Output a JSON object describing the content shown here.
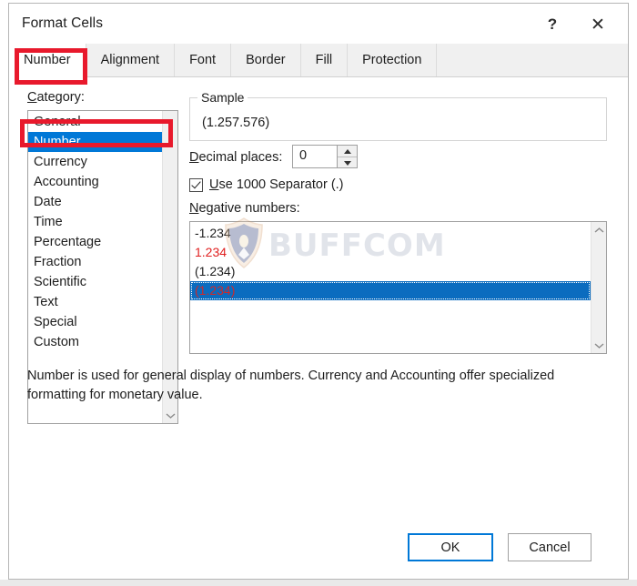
{
  "window": {
    "title": "Format Cells",
    "help_icon": "question-mark-icon",
    "close_icon": "close-icon"
  },
  "tabs": [
    {
      "label": "Number",
      "active": true
    },
    {
      "label": "Alignment",
      "active": false
    },
    {
      "label": "Font",
      "active": false
    },
    {
      "label": "Border",
      "active": false
    },
    {
      "label": "Fill",
      "active": false
    },
    {
      "label": "Protection",
      "active": false
    }
  ],
  "category": {
    "label": "Category:",
    "label_accel": "C",
    "items": [
      {
        "label": "General",
        "selected": false
      },
      {
        "label": "Number",
        "selected": true
      },
      {
        "label": "Currency",
        "selected": false
      },
      {
        "label": "Accounting",
        "selected": false
      },
      {
        "label": "Date",
        "selected": false
      },
      {
        "label": "Time",
        "selected": false
      },
      {
        "label": "Percentage",
        "selected": false
      },
      {
        "label": "Fraction",
        "selected": false
      },
      {
        "label": "Scientific",
        "selected": false
      },
      {
        "label": "Text",
        "selected": false
      },
      {
        "label": "Special",
        "selected": false
      },
      {
        "label": "Custom",
        "selected": false
      }
    ],
    "scroll_down_icon": "chevron-down-icon"
  },
  "sample": {
    "group_title": "Sample",
    "value": "(1.257.576)"
  },
  "decimal_places": {
    "label": "Decimal places:",
    "label_accel": "D",
    "value": "0",
    "up_icon": "triangle-up-icon",
    "down_icon": "triangle-down-icon"
  },
  "thousand_separator": {
    "label_prefix": "",
    "label_accel": "U",
    "label_rest": "se 1000 Separator (.)",
    "checked": true,
    "check_icon": "checkmark-icon"
  },
  "negative_numbers": {
    "label": "Negative numbers:",
    "label_accel": "N",
    "items": [
      {
        "label": "-1.234",
        "color": "black",
        "selected": false
      },
      {
        "label": "1.234",
        "color": "red",
        "selected": false
      },
      {
        "label": "(1.234)",
        "color": "black",
        "selected": false
      },
      {
        "label": "(1.234)",
        "color": "red",
        "selected": true
      }
    ],
    "scroll_up_icon": "chevron-up-icon",
    "scroll_down_icon": "chevron-down-icon"
  },
  "description": "Number is used for general display of numbers.  Currency and Accounting offer specialized formatting for monetary value.",
  "footer": {
    "ok_label": "OK",
    "cancel_label": "Cancel"
  },
  "watermark": {
    "text": "BUFFCOM",
    "logo": "shield-logo"
  },
  "colors": {
    "selection_blue": "#0078d7",
    "annotation_red": "#e8192c",
    "negative_red": "#e02020",
    "focus_blue": "#0078d7"
  }
}
